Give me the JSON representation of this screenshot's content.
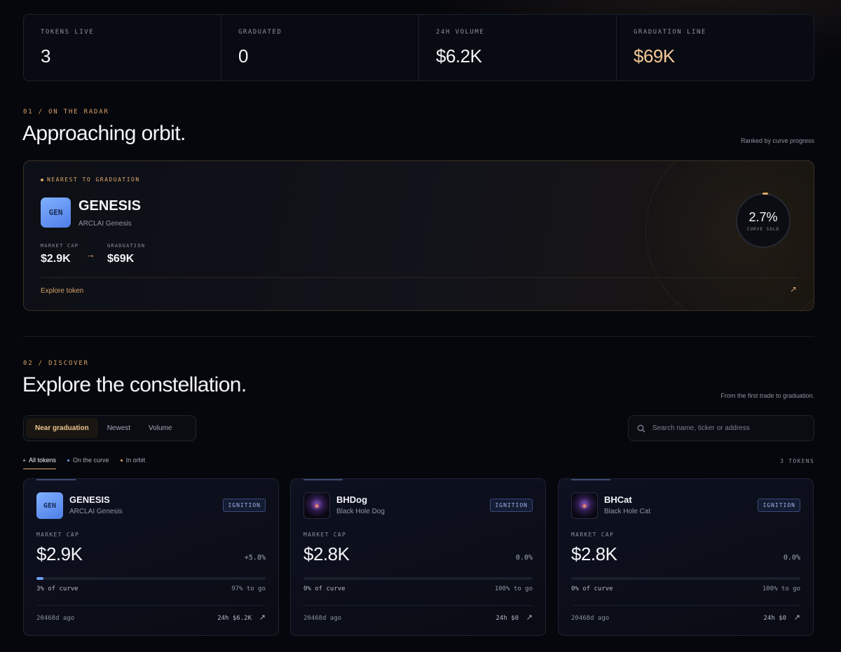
{
  "stats": [
    {
      "label": "TOKENS LIVE",
      "value": "3"
    },
    {
      "label": "GRADUATED",
      "value": "0"
    },
    {
      "label": "24H VOLUME",
      "value": "$6.2K"
    },
    {
      "label": "GRADUATION LINE",
      "value": "$69K"
    }
  ],
  "radar": {
    "kicker": "01 / ON THE RADAR",
    "title": "Approaching orbit.",
    "note": "Ranked by curve progress",
    "featured": {
      "kicker": "NEAREST TO GRADUATION",
      "avatar": "GEN",
      "name": "GENESIS",
      "subtitle": "ARCLAI Genesis",
      "market_cap_label": "MARKET CAP",
      "market_cap": "$2.9K",
      "arrow": "→",
      "graduation_label": "GRADUATION",
      "graduation": "$69K",
      "explore": "Explore token",
      "explore_icon": "↗",
      "gauge_value": "2.7%",
      "gauge_label": "CURVE SOLD"
    }
  },
  "discover": {
    "kicker": "02 / DISCOVER",
    "title": "Explore the constellation.",
    "note": "From the first trade to graduation.",
    "tabs": [
      "Near graduation",
      "Newest",
      "Volume"
    ],
    "search_placeholder": "Search name, ticker or address",
    "filters": [
      "All tokens",
      "On the curve",
      "In orbit"
    ],
    "count": "3 TOKENS"
  },
  "cards": [
    {
      "avatar": "GEN",
      "name": "GENESIS",
      "subtitle": "ARCLAI Genesis",
      "badge": "IGNITION",
      "market_cap_label": "MARKET CAP",
      "market_cap": "$2.9K",
      "change": "+5.8%",
      "progress": 0.03,
      "curve": "3% of curve",
      "to_go": "97% to go",
      "age": "20468d ago",
      "volume": "24h $6.2K",
      "link_icon": "↗"
    },
    {
      "avatar": "",
      "name": "BHDog",
      "subtitle": "Black Hole Dog",
      "badge": "IGNITION",
      "market_cap_label": "MARKET CAP",
      "market_cap": "$2.8K",
      "change": "0.0%",
      "progress": 0,
      "curve": "0% of curve",
      "to_go": "100% to go",
      "age": "20468d ago",
      "volume": "24h $0",
      "link_icon": "↗"
    },
    {
      "avatar": "",
      "name": "BHCat",
      "subtitle": "Black Hole Cat",
      "badge": "IGNITION",
      "market_cap_label": "MARKET CAP",
      "market_cap": "$2.8K",
      "change": "0.0%",
      "progress": 0,
      "curve": "0% of curve",
      "to_go": "100% to go",
      "age": "20468d ago",
      "volume": "24h $0",
      "link_icon": "↗"
    }
  ],
  "colors": {
    "accent": "#e0a96b",
    "progress": "#6f9cf2",
    "badge": "#9fb4ea"
  }
}
